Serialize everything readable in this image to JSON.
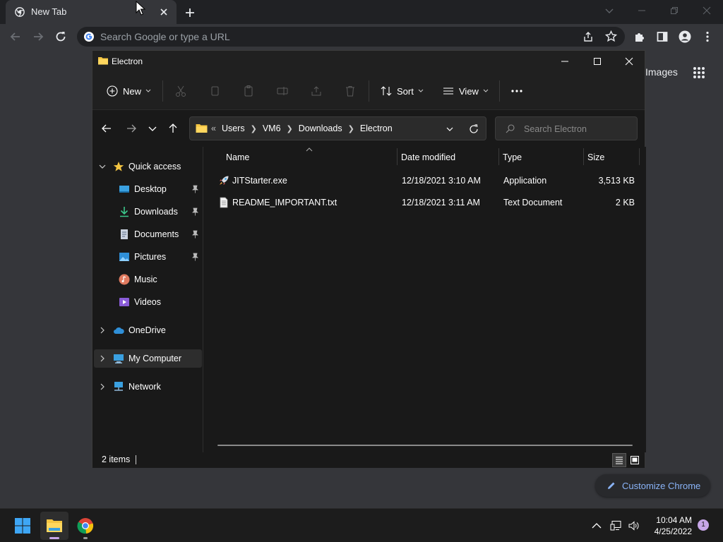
{
  "chrome": {
    "tab_title": "New Tab",
    "omnibox_placeholder": "Search Google or type a URL",
    "ntp_images_link": "Images",
    "customize_label": "Customize Chrome"
  },
  "explorer": {
    "window_title": "Electron",
    "commands": {
      "new_label": "New",
      "sort_label": "Sort",
      "view_label": "View"
    },
    "breadcrumbs": [
      "Users",
      "VM6",
      "Downloads",
      "Electron"
    ],
    "search_placeholder": "Search Electron",
    "nav": {
      "quick_access": "Quick access",
      "desktop": "Desktop",
      "downloads": "Downloads",
      "documents": "Documents",
      "pictures": "Pictures",
      "music": "Music",
      "videos": "Videos",
      "onedrive": "OneDrive",
      "my_computer": "My Computer",
      "network": "Network"
    },
    "columns": {
      "name": "Name",
      "date_modified": "Date modified",
      "type": "Type",
      "size": "Size"
    },
    "files": [
      {
        "name": "JITStarter.exe",
        "date": "12/18/2021 3:10 AM",
        "type": "Application",
        "size": "3,513 KB",
        "icon": "rocket-icon"
      },
      {
        "name": "README_IMPORTANT.txt",
        "date": "12/18/2021 3:11 AM",
        "type": "Text Document",
        "size": "2 KB",
        "icon": "text-file-icon"
      }
    ],
    "status_text": "2 items"
  },
  "taskbar": {
    "time": "10:04 AM",
    "date": "4/25/2022",
    "notification_count": "1"
  },
  "colors": {
    "chrome_frame": "#202124",
    "chrome_toolbar": "#35363a",
    "explorer_bg": "#191919",
    "folder_yellow": "#f4c542",
    "accent_blue": "#8ab4f8"
  }
}
